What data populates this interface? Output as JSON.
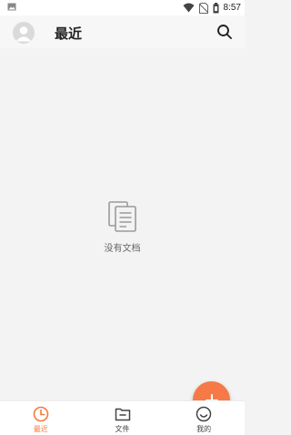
{
  "status_bar": {
    "time": "8:57"
  },
  "header": {
    "title": "最近"
  },
  "empty_state": {
    "message": "没有文档"
  },
  "bottom_nav": {
    "items": [
      {
        "label": "最近",
        "active": true
      },
      {
        "label": "文件",
        "active": false
      },
      {
        "label": "我的",
        "active": false
      }
    ]
  },
  "colors": {
    "accent": "#f5793e",
    "fab": "#f57a47",
    "background": "#f3f3f3"
  },
  "icons": [
    "image-icon",
    "wifi-icon",
    "no-sim-icon",
    "battery-icon",
    "avatar",
    "search-icon",
    "documents-icon",
    "plus-icon",
    "clock-icon",
    "folder-icon",
    "smiley-icon"
  ]
}
